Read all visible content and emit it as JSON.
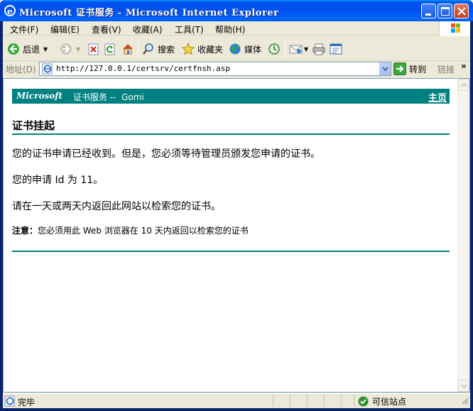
{
  "window": {
    "title": "Microsoft 证书服务 - Microsoft Internet Explorer"
  },
  "menubar": {
    "items": [
      "文件(F)",
      "编辑(E)",
      "查看(V)",
      "收藏(A)",
      "工具(T)",
      "帮助(H)"
    ]
  },
  "toolbar": {
    "back_label": "后退",
    "search_label": "搜索",
    "favorites_label": "收藏夹",
    "media_label": "媒体"
  },
  "address": {
    "label": "地址(D)",
    "url": "http://127.0.0.1/certsrv/certfnsh.asp",
    "go_label": "转到",
    "links_label": "链接"
  },
  "page": {
    "banner_brand": "Microsoft",
    "banner_title": "证书服务 --  Gomi",
    "home_link": "主页",
    "heading": "证书挂起",
    "para1": "您的证书申请已经收到。但是，您必须等待管理员颁发您申请的证书。",
    "para2": "您的申请 Id 为 11。",
    "para3": "请在一天或两天内返回此网站以检索您的证书。",
    "note_label": "注意：",
    "note_text": "您必须用此 Web 浏览器在 10 天内返回以检索您的证书"
  },
  "statusbar": {
    "status": "完毕",
    "zone": "可信站点"
  },
  "colors": {
    "accent": "#008080",
    "titlebar": "#0053ee"
  }
}
